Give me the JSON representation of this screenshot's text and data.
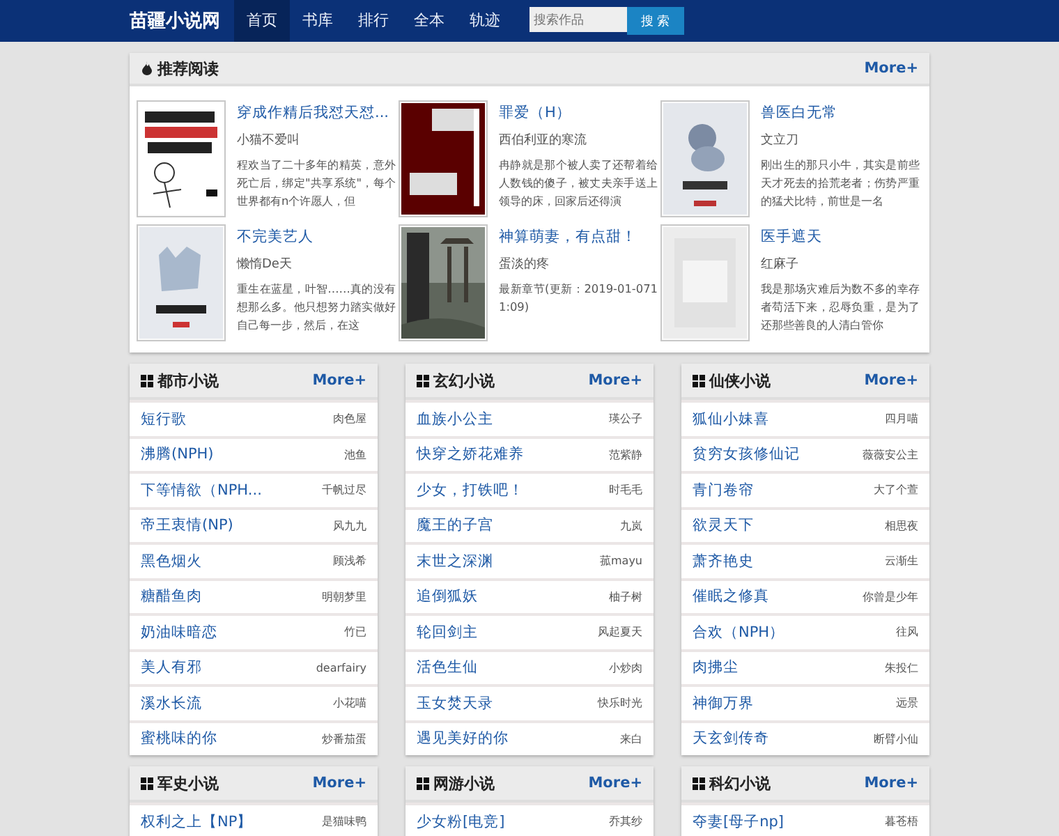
{
  "nav": {
    "logo": "苗疆小说网",
    "items": [
      {
        "label": "首页",
        "selected": true
      },
      {
        "label": "书库",
        "selected": false
      },
      {
        "label": "排行",
        "selected": false
      },
      {
        "label": "全本",
        "selected": false
      },
      {
        "label": "轨迹",
        "selected": false
      }
    ],
    "search": {
      "placeholder": "搜索作品",
      "button": "搜 索"
    }
  },
  "recommend": {
    "title": "推荐阅读",
    "more": "More+",
    "books": [
      {
        "title": "穿成作精后我怼天怼...",
        "author": "小猫不爱叫",
        "desc": "程欢当了二十多年的精英，意外死亡后，绑定\"共享系统\"，每个世界都有n个许愿人，但"
      },
      {
        "title": "罪爱（H）",
        "author": "西伯利亚的寒流",
        "desc": "冉静就是那个被人卖了还帮着给人数钱的傻子，被丈夫亲手送上领导的床，回家后还得演"
      },
      {
        "title": "兽医白无常",
        "author": "文立刀",
        "desc": "刚出生的那只小牛，其实是前些天才死去的拾荒老者；伤势严重的猛犬比特，前世是一名"
      },
      {
        "title": "不完美艺人",
        "author": "懒惰De天",
        "desc": "重生在蓝星，叶智……真的没有想那么多。他只想努力踏实做好自己每一步，然后，在这"
      },
      {
        "title": "神算萌妻，有点甜！",
        "author": "蛋淡的疼",
        "desc": "最新章节(更新：2019-01-0711:09)"
      },
      {
        "title": "医手遮天",
        "author": "红麻子",
        "desc": "我是那场灾难后为数不多的幸存者苟活下来，忍辱负重，是为了还那些善良的人清白管你"
      }
    ]
  },
  "sections": [
    {
      "title": "都市小说",
      "more": "More+",
      "items": [
        {
          "title": "短行歌",
          "author": "肉色屋"
        },
        {
          "title": "沸腾(NPH)",
          "author": "池鱼"
        },
        {
          "title": "下等情欲（NPH...",
          "author": "千帆过尽"
        },
        {
          "title": "帝王衷情(NP)",
          "author": "风九九"
        },
        {
          "title": "黑色烟火",
          "author": "顾浅希"
        },
        {
          "title": "糖醋鱼肉",
          "author": "明朝梦里"
        },
        {
          "title": "奶油味暗恋",
          "author": "竹已"
        },
        {
          "title": "美人有邪",
          "author": "dearfairy"
        },
        {
          "title": "溪水长流",
          "author": "小花喵"
        },
        {
          "title": "蜜桃味的你",
          "author": "炒番茄蛋"
        }
      ]
    },
    {
      "title": "玄幻小说",
      "more": "More+",
      "items": [
        {
          "title": "血族小公主",
          "author": "瑛公子"
        },
        {
          "title": "快穿之娇花难养",
          "author": "范紫静"
        },
        {
          "title": "少女，打铁吧！",
          "author": "时毛毛"
        },
        {
          "title": "魔王的子宫",
          "author": "九岚"
        },
        {
          "title": "末世之深渊",
          "author": "菰mayu"
        },
        {
          "title": "追倒狐妖",
          "author": "柚子树"
        },
        {
          "title": "轮回剑主",
          "author": "风起夏天"
        },
        {
          "title": "活色生仙",
          "author": "小炒肉"
        },
        {
          "title": "玉女焚天录",
          "author": "快乐时光"
        },
        {
          "title": "遇见美好的你",
          "author": "来白"
        }
      ]
    },
    {
      "title": "仙侠小说",
      "more": "More+",
      "items": [
        {
          "title": "狐仙小妹喜",
          "author": "四月喵"
        },
        {
          "title": "贫穷女孩修仙记",
          "author": "薇薇安公主"
        },
        {
          "title": "青门卷帘",
          "author": "大了个萱"
        },
        {
          "title": "欲灵天下",
          "author": "相思夜"
        },
        {
          "title": "萧齐艳史",
          "author": "云渐生"
        },
        {
          "title": "催眠之修真",
          "author": "你曾是少年"
        },
        {
          "title": "合欢（NPH）",
          "author": "往风"
        },
        {
          "title": "肉拂尘",
          "author": "朱投仁"
        },
        {
          "title": "神御万界",
          "author": "远景"
        },
        {
          "title": "天玄剑传奇",
          "author": "断臂小仙"
        }
      ]
    },
    {
      "title": "军史小说",
      "more": "More+",
      "items": [
        {
          "title": "权利之上【NP】",
          "author": "是猫味鸭"
        }
      ]
    },
    {
      "title": "网游小说",
      "more": "More+",
      "items": [
        {
          "title": "少女粉[电竞]",
          "author": "乔其纱"
        }
      ]
    },
    {
      "title": "科幻小说",
      "more": "More+",
      "items": [
        {
          "title": "夺妻[母子np]",
          "author": "暮苍梧"
        }
      ]
    }
  ]
}
